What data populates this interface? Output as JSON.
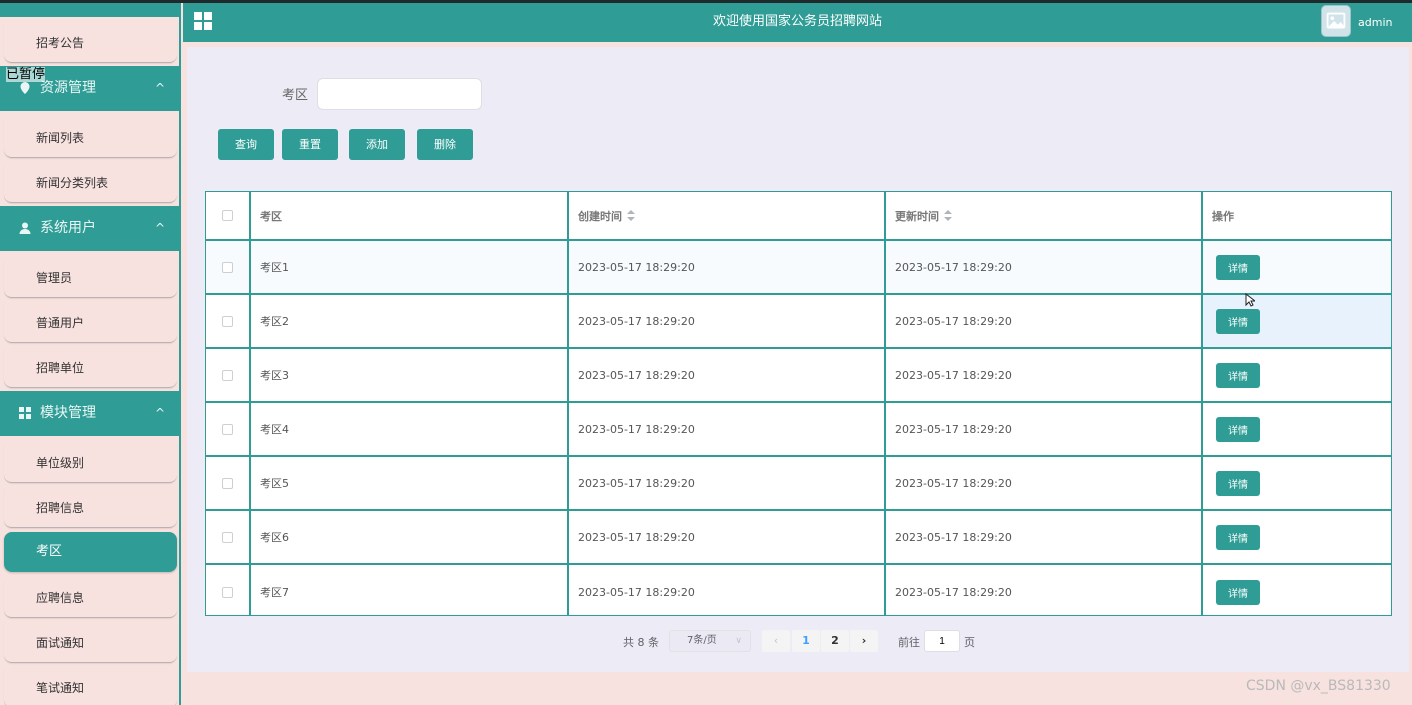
{
  "header": {
    "title": "欢迎使用国家公务员招聘网站",
    "username": "admin"
  },
  "overlay": {
    "paused": "已暂停"
  },
  "sidebar": {
    "top_item": "招考公告",
    "groups": [
      {
        "label": "资源管理",
        "items": [
          "新闻列表",
          "新闻分类列表"
        ]
      },
      {
        "label": "系统用户",
        "items": [
          "管理员",
          "普通用户",
          "招聘单位"
        ]
      },
      {
        "label": "模块管理",
        "items": [
          "单位级别",
          "招聘信息",
          "考区",
          "应聘信息",
          "面试通知",
          "笔试通知"
        ]
      }
    ],
    "active": "考区"
  },
  "search": {
    "label": "考区",
    "value": "",
    "placeholder": ""
  },
  "buttons": {
    "query": "查询",
    "reset": "重置",
    "add": "添加",
    "delete": "删除"
  },
  "table": {
    "headers": [
      "考区",
      "创建时间",
      "更新时间",
      "操作"
    ],
    "action_label": "详情",
    "rows": [
      {
        "name": "考区1",
        "created": "2023-05-17 18:29:20",
        "updated": "2023-05-17 18:29:20"
      },
      {
        "name": "考区2",
        "created": "2023-05-17 18:29:20",
        "updated": "2023-05-17 18:29:20"
      },
      {
        "name": "考区3",
        "created": "2023-05-17 18:29:20",
        "updated": "2023-05-17 18:29:20"
      },
      {
        "name": "考区4",
        "created": "2023-05-17 18:29:20",
        "updated": "2023-05-17 18:29:20"
      },
      {
        "name": "考区5",
        "created": "2023-05-17 18:29:20",
        "updated": "2023-05-17 18:29:20"
      },
      {
        "name": "考区6",
        "created": "2023-05-17 18:29:20",
        "updated": "2023-05-17 18:29:20"
      },
      {
        "name": "考区7",
        "created": "2023-05-17 18:29:20",
        "updated": "2023-05-17 18:29:20"
      }
    ]
  },
  "pagination": {
    "total": "共 8 条",
    "page_size": "7条/页",
    "pages": [
      "1",
      "2"
    ],
    "current": "1",
    "goto_label": "前往",
    "goto_value": "1",
    "page_suffix": "页"
  },
  "watermark": "CSDN @vx_BS81330",
  "colors": {
    "accent": "#2f9d95",
    "sidebar_bg": "#f7e2df",
    "main_bg": "#ecebf6"
  }
}
